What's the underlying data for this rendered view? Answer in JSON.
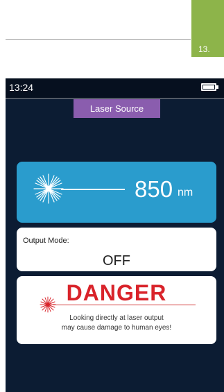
{
  "document": {
    "page_number": "13."
  },
  "status_bar": {
    "time": "13:24",
    "battery_icon": "battery-full-icon"
  },
  "screen": {
    "title": "Laser Source"
  },
  "wavelength": {
    "value": "850",
    "unit": "nm",
    "icon": "laser-burst-icon"
  },
  "output_mode": {
    "label": "Output Mode:",
    "value": "OFF"
  },
  "warning": {
    "title": "DANGER",
    "line1": "Looking directly at laser output",
    "line2": "may cause damage to human eyes!",
    "icon": "laser-burst-icon"
  },
  "colors": {
    "screen_bg": "#0c1c33",
    "title_tab": "#8a5dae",
    "wavelength_panel": "#2a9ccd",
    "danger_red": "#d9232a",
    "page_tab": "#8db44a"
  }
}
